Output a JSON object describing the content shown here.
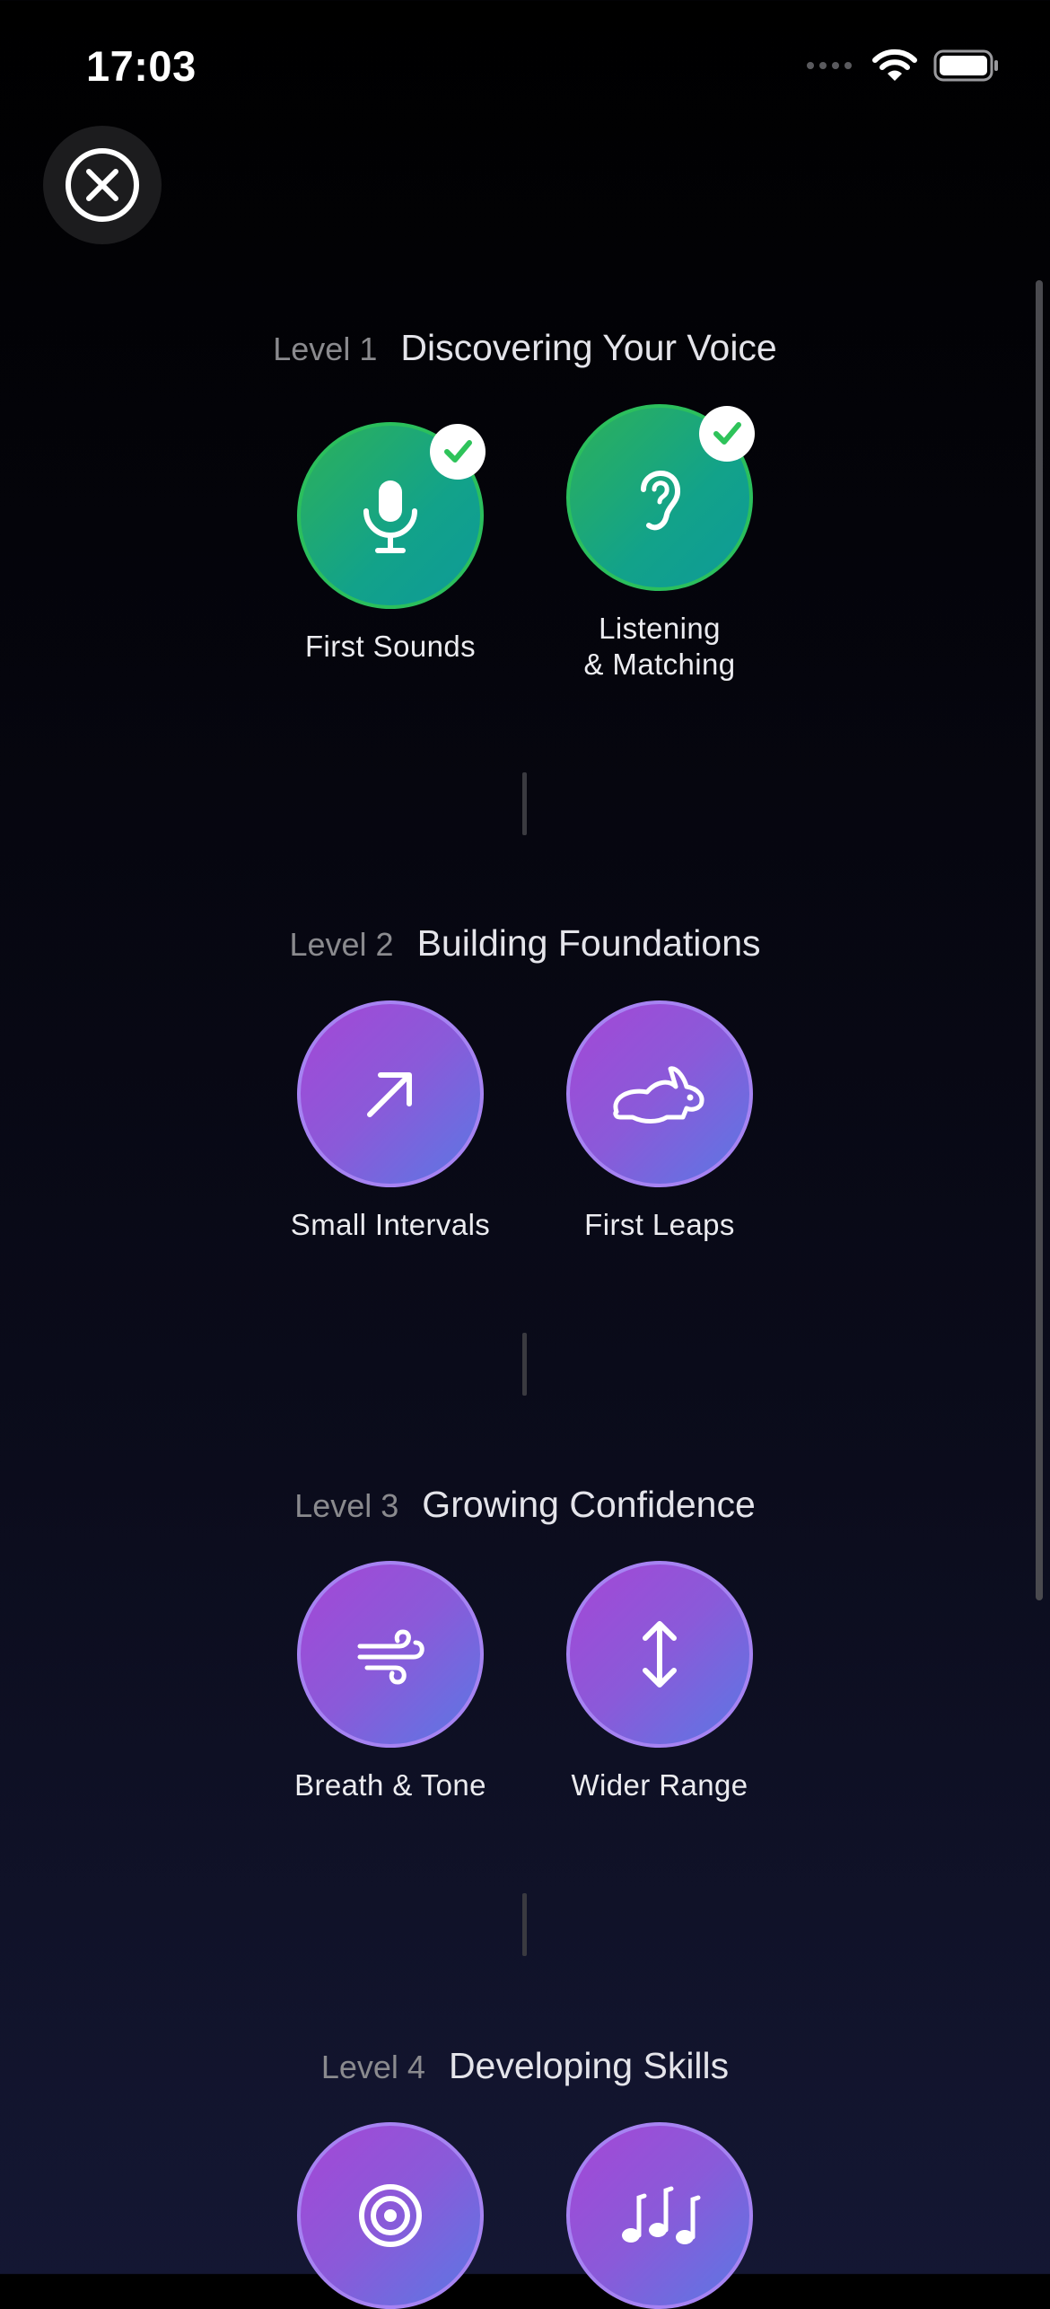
{
  "status_bar": {
    "time": "17:03"
  },
  "colors": {
    "completed": "#2db15a",
    "locked_accent": "#a447d6",
    "check": "#2ec35a"
  },
  "levels": [
    {
      "number": "Level 1",
      "title": "Discovering Your Voice",
      "lessons": [
        {
          "label": "First Sounds",
          "icon": "microphone-icon",
          "completed": true
        },
        {
          "label_line1": "Listening",
          "label_line2": "& Matching",
          "icon": "ear-icon",
          "completed": true
        }
      ]
    },
    {
      "number": "Level 2",
      "title": "Building Foundations",
      "lessons": [
        {
          "label": "Small Intervals",
          "icon": "arrow-up-right-icon",
          "completed": false
        },
        {
          "label": "First Leaps",
          "icon": "rabbit-icon",
          "completed": false
        }
      ]
    },
    {
      "number": "Level 3",
      "title": "Growing Confidence",
      "lessons": [
        {
          "label": "Breath & Tone",
          "icon": "wind-icon",
          "completed": false
        },
        {
          "label": "Wider Range",
          "icon": "arrow-up-down-icon",
          "completed": false
        }
      ]
    },
    {
      "number": "Level 4",
      "title": "Developing Skills",
      "lessons": [
        {
          "label": "",
          "icon": "target-icon",
          "completed": false
        },
        {
          "label": "",
          "icon": "music-notes-icon",
          "completed": false
        }
      ]
    }
  ]
}
